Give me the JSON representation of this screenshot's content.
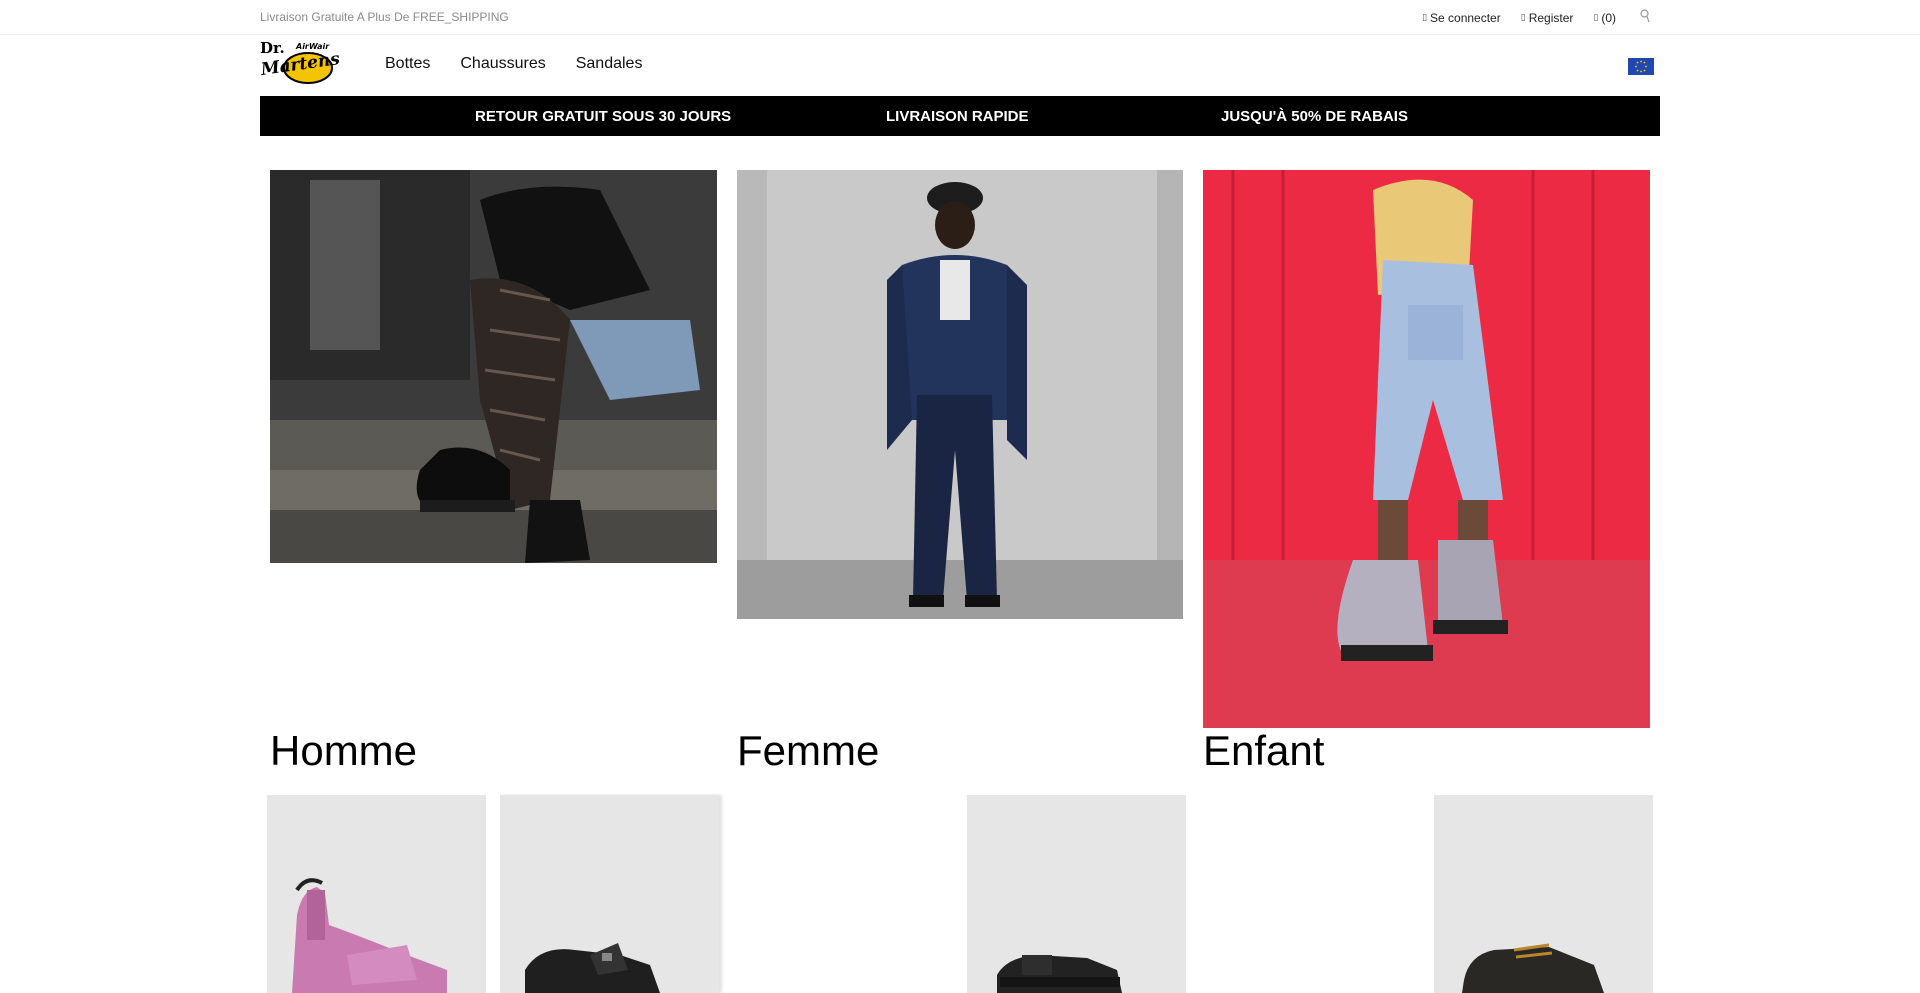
{
  "topbar": {
    "promo": "Livraison Gratuite A Plus De FREE_SHIPPING",
    "login": "Se connecter",
    "register": "Register",
    "cart": "(0)",
    "login_icon": "user-icon",
    "register_icon": "user-plus-icon",
    "cart_icon": "cart-icon",
    "search_icon": "search-icon"
  },
  "header": {
    "logo_text_1": "Dr.",
    "logo_text_2": "Martens",
    "logo_text_3": "AirWair",
    "nav": [
      "Bottes",
      "Chaussures",
      "Sandales"
    ],
    "language_icon": "eu-flag-icon"
  },
  "banner": {
    "items": [
      "RETOUR GRATUIT SOUS 30 JOURS",
      "LIVRAISON RAPIDE",
      "JUSQU'À 50% DE RABAIS"
    ]
  },
  "categories": [
    {
      "title": "Homme"
    },
    {
      "title": "Femme"
    },
    {
      "title": "Enfant"
    }
  ],
  "colors": {
    "accent": "#000000",
    "tile_bg": "#e6e6e6",
    "flag_blue": "#1f48b3",
    "flag_star": "#ffcc00"
  }
}
